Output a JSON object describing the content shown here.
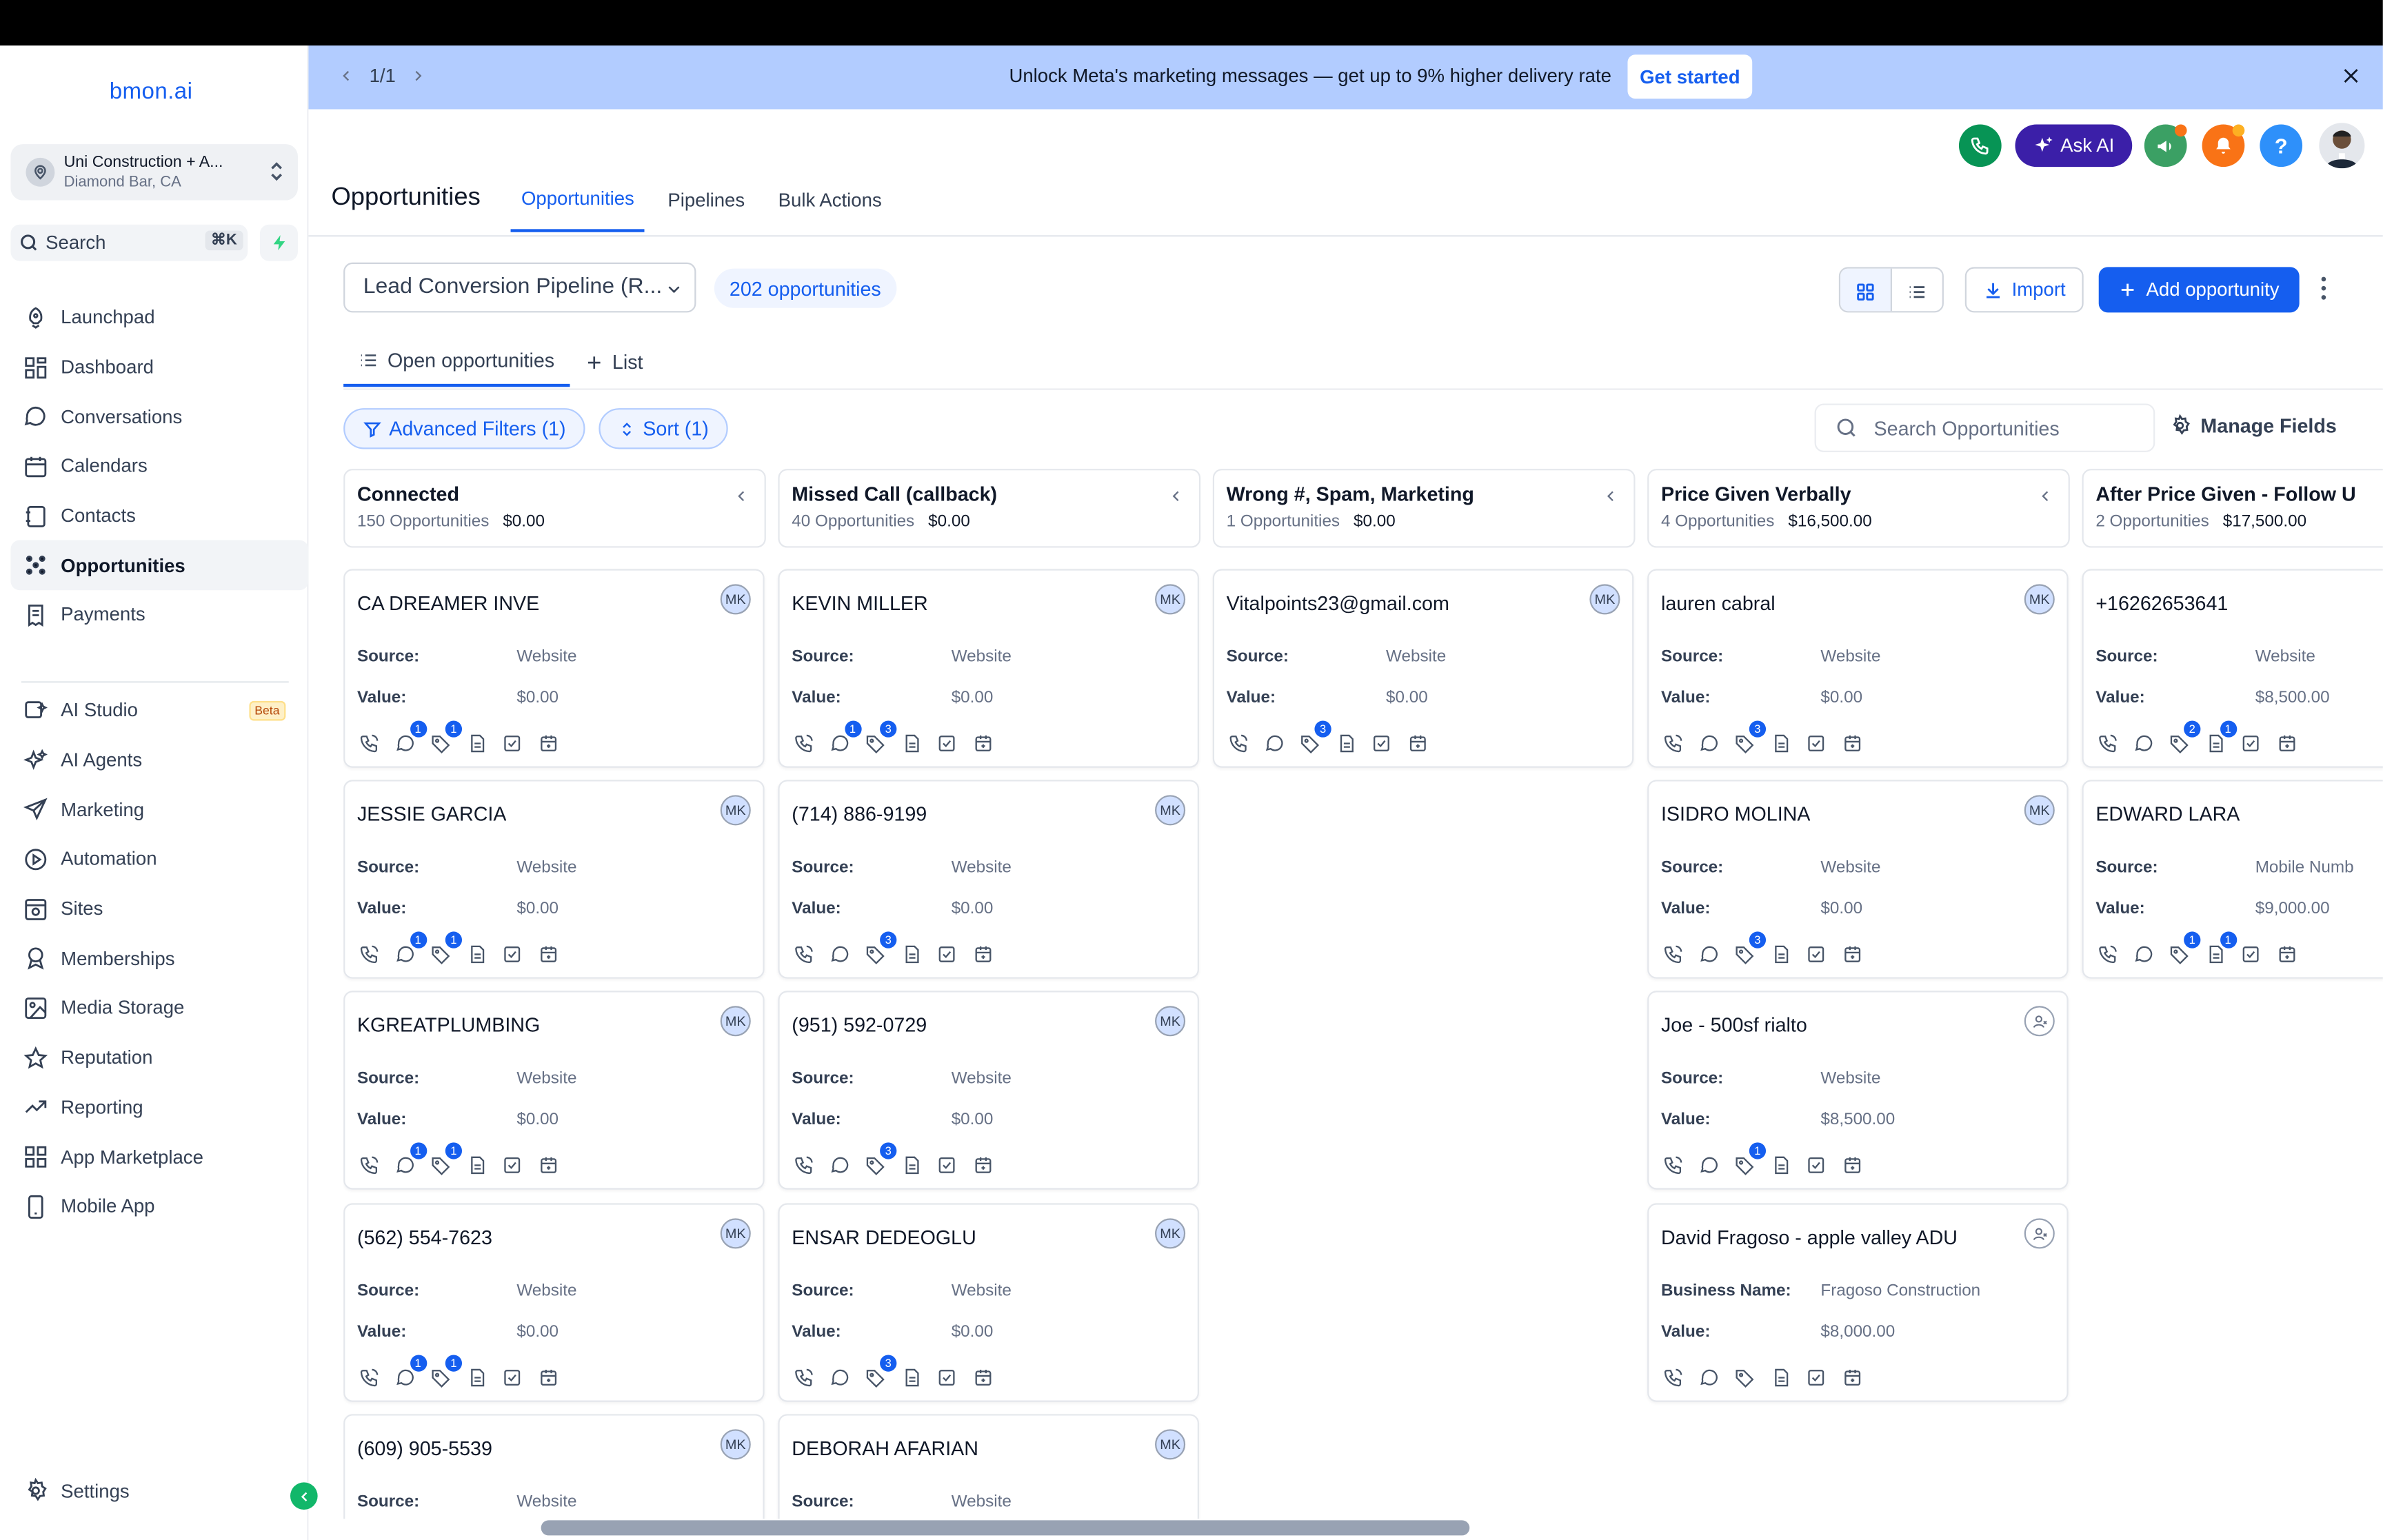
{
  "app": {
    "logo": "bmon.ai"
  },
  "location": {
    "name": "Uni Construction + A...",
    "city": "Diamond Bar, CA"
  },
  "search": {
    "label": "Search",
    "shortcut": "⌘K"
  },
  "nav": [
    {
      "label": "Launchpad",
      "icon": "rocket-icon"
    },
    {
      "label": "Dashboard",
      "icon": "grid-icon"
    },
    {
      "label": "Conversations",
      "icon": "chat-icon"
    },
    {
      "label": "Calendars",
      "icon": "calendar-icon"
    },
    {
      "label": "Contacts",
      "icon": "contacts-icon"
    },
    {
      "label": "Opportunities",
      "icon": "pipeline-icon",
      "active": true
    },
    {
      "label": "Payments",
      "icon": "receipt-icon"
    }
  ],
  "nav2": [
    {
      "label": "AI Studio",
      "icon": "ai-studio-icon",
      "badge": "Beta"
    },
    {
      "label": "AI Agents",
      "icon": "sparkles-icon"
    },
    {
      "label": "Marketing",
      "icon": "send-icon"
    },
    {
      "label": "Automation",
      "icon": "play-circle-icon"
    },
    {
      "label": "Sites",
      "icon": "sites-icon"
    },
    {
      "label": "Memberships",
      "icon": "award-icon"
    },
    {
      "label": "Media Storage",
      "icon": "image-icon"
    },
    {
      "label": "Reputation",
      "icon": "star-icon"
    },
    {
      "label": "Reporting",
      "icon": "trend-icon"
    },
    {
      "label": "App Marketplace",
      "icon": "apps-icon"
    },
    {
      "label": "Mobile App",
      "icon": "phone-device-icon"
    }
  ],
  "settings": {
    "label": "Settings"
  },
  "banner": {
    "pager": "1/1",
    "message": "Unlock Meta's marketing messages — get up to 9% higher delivery rate",
    "cta": "Get started"
  },
  "header": {
    "ask_ai": "Ask AI",
    "title": "Opportunities",
    "tabs": [
      "Opportunities",
      "Pipelines",
      "Bulk Actions"
    ]
  },
  "toolbar": {
    "pipeline": "Lead Conversion Pipeline (R...",
    "count": "202 opportunities",
    "import": "Import",
    "add": "Add opportunity"
  },
  "subtabs": {
    "open": "Open opportunities",
    "list": "List"
  },
  "filters": {
    "advanced": "Advanced Filters (1)",
    "sort": "Sort (1)",
    "search_placeholder": "Search Opportunities",
    "manage_fields": "Manage Fields"
  },
  "colors": {
    "accent": "#155eef",
    "banner": "#b2ccff",
    "ask_ai": "#3b1fa8",
    "call": "#079455",
    "notif": "#f97316"
  },
  "columns": [
    {
      "title": "Connected",
      "count": "150 Opportunities",
      "value": "$0.00",
      "cards": [
        {
          "name": "CA DREAMER INVE",
          "avatar": "MK",
          "f1": "Source:",
          "v1": "Website",
          "f2": "Value:",
          "v2": "$0.00",
          "badges": {
            "chat": "1",
            "tag": "1"
          }
        },
        {
          "name": "JESSIE GARCIA",
          "avatar": "MK",
          "f1": "Source:",
          "v1": "Website",
          "f2": "Value:",
          "v2": "$0.00",
          "badges": {
            "chat": "1",
            "tag": "1"
          }
        },
        {
          "name": "KGREATPLUMBING",
          "avatar": "MK",
          "f1": "Source:",
          "v1": "Website",
          "f2": "Value:",
          "v2": "$0.00",
          "badges": {
            "chat": "1",
            "tag": "1"
          }
        },
        {
          "name": "(562) 554-7623",
          "avatar": "MK",
          "f1": "Source:",
          "v1": "Website",
          "f2": "Value:",
          "v2": "$0.00",
          "badges": {
            "chat": "1",
            "tag": "1"
          }
        },
        {
          "name": "(609) 905-5539",
          "avatar": "MK",
          "f1": "Source:",
          "v1": "Website",
          "f2": "Value:",
          "v2": "",
          "badges": {}
        }
      ]
    },
    {
      "title": "Missed Call (callback)",
      "count": "40 Opportunities",
      "value": "$0.00",
      "cards": [
        {
          "name": "KEVIN MILLER",
          "avatar": "MK",
          "f1": "Source:",
          "v1": "Website",
          "f2": "Value:",
          "v2": "$0.00",
          "badges": {
            "chat": "1",
            "tag": "3"
          }
        },
        {
          "name": "(714) 886-9199",
          "avatar": "MK",
          "f1": "Source:",
          "v1": "Website",
          "f2": "Value:",
          "v2": "$0.00",
          "badges": {
            "tag": "3"
          }
        },
        {
          "name": "(951) 592-0729",
          "avatar": "MK",
          "f1": "Source:",
          "v1": "Website",
          "f2": "Value:",
          "v2": "$0.00",
          "badges": {
            "tag": "3"
          }
        },
        {
          "name": "ENSAR DEDEOGLU",
          "avatar": "MK",
          "f1": "Source:",
          "v1": "Website",
          "f2": "Value:",
          "v2": "$0.00",
          "badges": {
            "tag": "3"
          }
        },
        {
          "name": "DEBORAH AFARIAN",
          "avatar": "MK",
          "f1": "Source:",
          "v1": "Website",
          "f2": "Value:",
          "v2": "",
          "badges": {}
        }
      ]
    },
    {
      "title": "Wrong #, Spam, Marketing",
      "count": "1 Opportunities",
      "value": "$0.00",
      "cards": [
        {
          "name": "Vitalpoints23@gmail.com",
          "avatar": "MK",
          "f1": "Source:",
          "v1": "Website",
          "f2": "Value:",
          "v2": "$0.00",
          "badges": {
            "tag": "3"
          }
        }
      ]
    },
    {
      "title": "Price Given Verbally",
      "count": "4 Opportunities",
      "value": "$16,500.00",
      "cards": [
        {
          "name": "lauren cabral",
          "avatar": "MK",
          "f1": "Source:",
          "v1": "Website",
          "f2": "Value:",
          "v2": "$0.00",
          "badges": {
            "tag": "3"
          }
        },
        {
          "name": "ISIDRO MOLINA",
          "avatar": "MK",
          "f1": "Source:",
          "v1": "Website",
          "f2": "Value:",
          "v2": "$0.00",
          "badges": {
            "tag": "3"
          }
        },
        {
          "name": "Joe - 500sf rialto",
          "avatar": "",
          "f1": "Source:",
          "v1": "Website",
          "f2": "Value:",
          "v2": "$8,500.00",
          "badges": {
            "tag": "1"
          }
        },
        {
          "name": "David Fragoso - apple valley ADU",
          "avatar": "",
          "f1": "Business Name:",
          "v1": "Fragoso Construction",
          "f2": "Value:",
          "v2": "$8,000.00",
          "badges": {}
        }
      ]
    },
    {
      "title": "After Price Given - Follow U",
      "count": "2 Opportunities",
      "value": "$17,500.00",
      "cards": [
        {
          "name": "+16262653641",
          "avatar": "MK",
          "f1": "Source:",
          "v1": "Website",
          "f2": "Value:",
          "v2": "$8,500.00",
          "badges": {
            "tag": "2",
            "doc": "1"
          }
        },
        {
          "name": "EDWARD LARA",
          "avatar": "MK",
          "f1": "Source:",
          "v1": "Mobile Numb",
          "f2": "Value:",
          "v2": "$9,000.00",
          "badges": {
            "tag": "1",
            "doc": "1"
          }
        }
      ]
    }
  ]
}
